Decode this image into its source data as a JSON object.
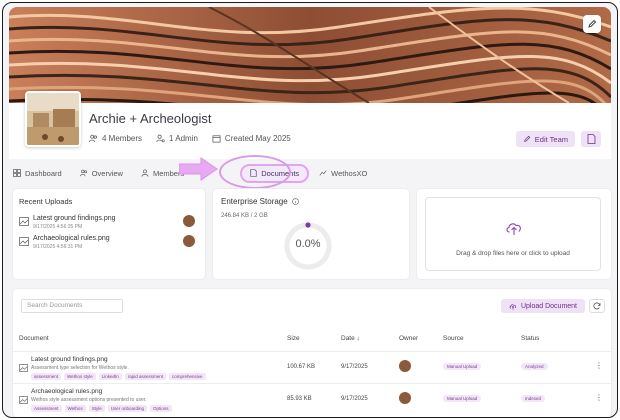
{
  "team": {
    "name": "Archie + Archeologist",
    "members": "4 Members",
    "admins": "1 Admin",
    "created": "Created May 2025",
    "edit_team_label": "Edit Team"
  },
  "tabs": [
    {
      "label": "Dashboard",
      "icon": "grid-icon",
      "active": false
    },
    {
      "label": "Overview",
      "icon": "users-icon",
      "active": false
    },
    {
      "label": "Members",
      "icon": "user-icon",
      "active": false
    },
    {
      "label": "Documents",
      "icon": "document-icon",
      "active": true
    },
    {
      "label": "WethosXO",
      "icon": "chart-icon",
      "active": false
    }
  ],
  "recent_uploads": {
    "title": "Recent Uploads",
    "items": [
      {
        "name": "Latest ground findings.png",
        "date": "9/17/2025 4:56:35 PM"
      },
      {
        "name": "Archaeological rules.png",
        "date": "9/17/2025 4:56:31 PM"
      }
    ]
  },
  "storage": {
    "title": "Enterprise Storage",
    "used": "246.84 KB / 2 GB",
    "percent_label": "0.0%",
    "fraction": 0.0
  },
  "dropzone": {
    "text": "Drag & drop files here or click to upload"
  },
  "documents": {
    "search_placeholder": "Search Documents",
    "upload_label": "Upload Document",
    "columns": {
      "document": "Document",
      "size": "Size",
      "date": "Date",
      "owner": "Owner",
      "source": "Source",
      "status": "Status"
    },
    "rows": [
      {
        "name": "Latest ground findings.png",
        "desc": "Assessment type selection for Wethos style.",
        "tags": [
          "assessment",
          "Wethos style",
          "LinkedIn",
          "rapid assessment",
          "comprehensive"
        ],
        "size": "100.67 KB",
        "date": "9/17/2025",
        "source": "Manual Upload",
        "status": "Analyzed"
      },
      {
        "name": "Archaeological rules.png",
        "desc": "Wethos style assessment options presented to user.",
        "tags": [
          "Assessment",
          "Wethos",
          "Style",
          "User onboarding",
          "Options"
        ],
        "size": "85.93 KB",
        "date": "9/17/2025",
        "source": "Manual Upload",
        "status": "Indexed"
      }
    ]
  },
  "colors": {
    "accent": "#6d2d8a",
    "accent_bg": "#efe2f7",
    "highlight": "#e1a5ef",
    "banner_dark": "#2b1b14",
    "banner_light": "#e8b48c"
  }
}
